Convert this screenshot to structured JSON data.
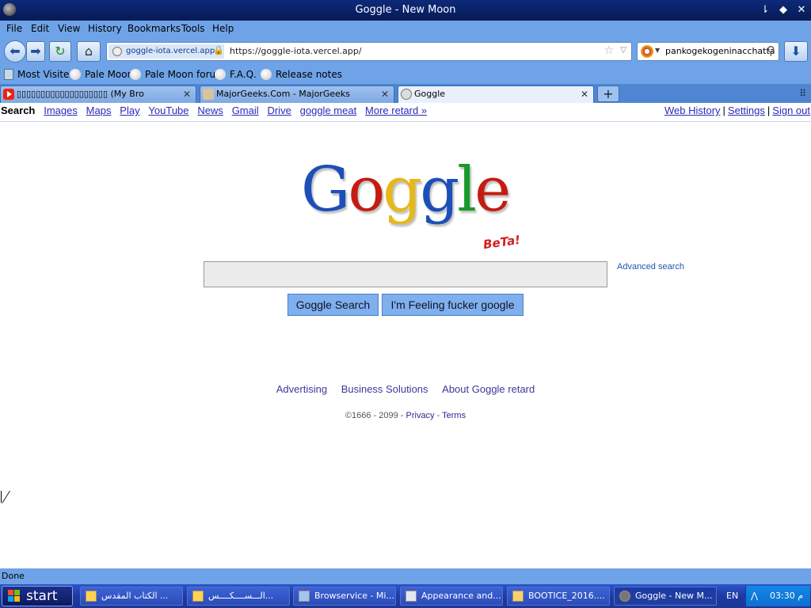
{
  "window": {
    "title": "Goggle - New Moon",
    "controls": [
      "⇂",
      "◆",
      "✕"
    ]
  },
  "menu": [
    "File",
    "Edit",
    "View",
    "History",
    "Bookmarks",
    "Tools",
    "Help"
  ],
  "nav": {
    "site_identity": "goggle-iota.vercel.app",
    "url": "https://goggle-iota.vercel.app/",
    "search_query": "pankogekogeninacchatta"
  },
  "bookmarks": [
    "Most Visited",
    "Pale Moon",
    "Pale Moon forum",
    "F.A.Q.",
    "Release notes"
  ],
  "tabs": [
    {
      "title": "▯▯▯▯▯▯▯▯▯▯▯▯▯▯▯▯▯▯▯ (My Bro",
      "icon": "youtube-icon"
    },
    {
      "title": "MajorGeeks.Com - MajorGeeks",
      "icon": "majorgeeks-icon"
    },
    {
      "title": "Goggle",
      "icon": "globe-icon",
      "active": true
    }
  ],
  "gbar": {
    "current": "Search",
    "links": [
      "Images",
      "Maps",
      "Play",
      "YouTube",
      "News",
      "Gmail",
      "Drive",
      "goggle meat",
      "More retard »"
    ],
    "right": [
      "Web History",
      "Settings",
      "Sign out"
    ]
  },
  "logo": {
    "letters": [
      "G",
      "o",
      "g",
      "g",
      "l",
      "e"
    ],
    "beta": "BeTa!"
  },
  "search": {
    "advanced": "Advanced search",
    "button_search": "Goggle Search",
    "button_lucky": "I'm Feeling fucker google"
  },
  "footer": {
    "links": [
      "Advertising",
      "Business Solutions",
      "About Goggle retard"
    ],
    "copyright": "©1666 - 2099 - ",
    "privacy": "Privacy",
    "dash": " - ",
    "terms": "Terms"
  },
  "status": "Done",
  "taskbar": {
    "start": "start",
    "tasks": [
      {
        "label": "الكتاب المقدس ..."
      },
      {
        "label": "الـــســــكــــس..."
      },
      {
        "label": "Browservice - Mi..."
      },
      {
        "label": "Appearance and..."
      },
      {
        "label": "BOOTICE_2016...."
      },
      {
        "label": "Goggle - New M...",
        "active": true
      }
    ],
    "lang": "EN",
    "clock": "03:30 م"
  },
  "colors": {
    "chrome": "#6fa3e7",
    "titlebar": "#0d2a7a",
    "taskbar": "#1d3aa3",
    "link": "#2a2ab8"
  }
}
